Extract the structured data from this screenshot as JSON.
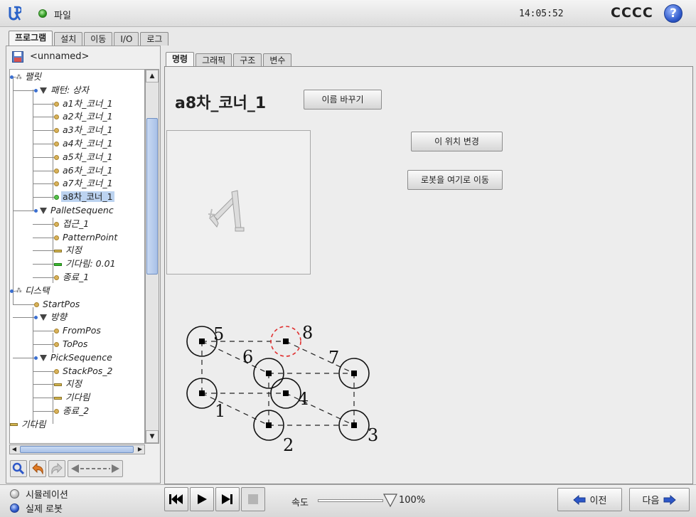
{
  "topbar": {
    "menu_file": "파일",
    "clock": "14:05:52",
    "robot_name": "CCCC",
    "help": "?"
  },
  "main_tabs": [
    "프로그램",
    "설치",
    "이동",
    "I/O",
    "로그"
  ],
  "program": {
    "name": "<unnamed>"
  },
  "tree": [
    {
      "label": "팰릿",
      "icon": "pallet-icon"
    },
    {
      "label": "패턴: 상자",
      "icon": "triangle-icon"
    },
    {
      "label": "a1차_코너_1",
      "icon": "waypoint-icon"
    },
    {
      "label": "a2차_코너_1",
      "icon": "waypoint-icon"
    },
    {
      "label": "a3차_코너_1",
      "icon": "waypoint-icon"
    },
    {
      "label": "a4차_코너_1",
      "icon": "waypoint-icon"
    },
    {
      "label": "a5차_코너_1",
      "icon": "waypoint-icon"
    },
    {
      "label": "a6차_코너_1",
      "icon": "waypoint-icon"
    },
    {
      "label": "a7차_코너_1",
      "icon": "waypoint-icon"
    },
    {
      "label": "a8차_코너_1",
      "icon": "waypoint-icon",
      "selected": true
    },
    {
      "label": "PalletSequenc",
      "icon": "triangle-icon"
    },
    {
      "label": "접근_1",
      "icon": "waypoint-icon"
    },
    {
      "label": "PatternPoint",
      "icon": "waypoint-icon"
    },
    {
      "label": "지정",
      "icon": "set-icon"
    },
    {
      "label": "기다림: 0.01",
      "icon": "wait-icon"
    },
    {
      "label": "종료_1",
      "icon": "waypoint-icon"
    },
    {
      "label": "디스택",
      "icon": "pallet-icon"
    },
    {
      "label": "StartPos",
      "icon": "waypoint-icon"
    },
    {
      "label": "방향",
      "icon": "triangle-icon"
    },
    {
      "label": "FromPos",
      "icon": "waypoint-icon"
    },
    {
      "label": "ToPos",
      "icon": "waypoint-icon"
    },
    {
      "label": "PickSequence",
      "icon": "triangle-icon"
    },
    {
      "label": "StackPos_2",
      "icon": "waypoint-icon"
    },
    {
      "label": "지정",
      "icon": "set-icon"
    },
    {
      "label": "기다림",
      "icon": "set-icon"
    },
    {
      "label": "종료_2",
      "icon": "waypoint-icon"
    },
    {
      "label": "기다림",
      "icon": "set-icon"
    }
  ],
  "command_tabs": [
    "명령",
    "그래픽",
    "구조",
    "변수"
  ],
  "waypoint": {
    "title": "a8차_코너_1",
    "rename_label": "이름 바꾸기",
    "set_position_label": "이 위치 변경",
    "move_here_label": "로봇을 여기로 이동"
  },
  "diagram": {
    "labels": [
      "1",
      "2",
      "3",
      "4",
      "5",
      "6",
      "7",
      "8"
    ],
    "highlight": "8"
  },
  "bottom": {
    "simulation_label": "시뮬레이션",
    "real_robot_label": "실제 로봇",
    "speed_label": "속도",
    "speed_value": "100%",
    "prev_label": "이전",
    "next_label": "다음"
  },
  "colors": {
    "accent": "#2d57c8",
    "selection": "#bcd3f0",
    "highlight_circle": "#e03030"
  }
}
